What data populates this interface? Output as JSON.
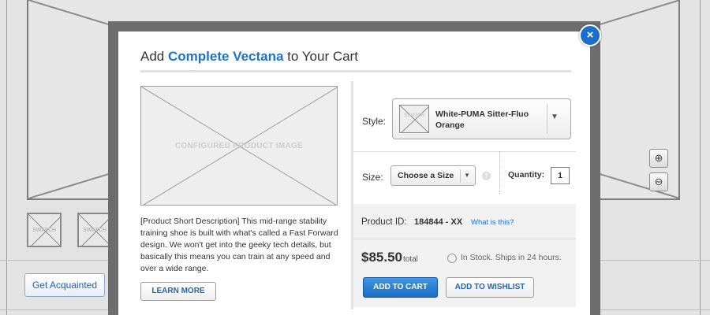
{
  "background": {
    "thumbnails": [
      "SWATCH",
      "SWATCH"
    ],
    "get_acquainted_label": "Get Acquainted",
    "zoom_in_glyph": "⊕",
    "zoom_out_glyph": "⊖"
  },
  "modal": {
    "title_prefix": "Add ",
    "title_product": "Complete Vectana",
    "title_suffix": " to Your Cart",
    "close_glyph": "×",
    "image_label": "CONFIGURED PRODUCT IMAGE",
    "description": "[Product Short Description]  This mid-range stability training shoe is built with what's called a Fast Forward design. We won't get into the geeky tech details, but basically this means you can train at any speed and over a wide range.",
    "learn_more_label": "LEARN MORE",
    "style": {
      "label": "Style:",
      "thumb_label": "SWATCH",
      "selected": "White-PUMA Sitter-Fluo Orange",
      "arrow": "▼"
    },
    "size": {
      "label": "Size:",
      "selected": "Choose a Size",
      "arrow": "▼",
      "help_glyph": "?"
    },
    "quantity": {
      "label": "Quantity:",
      "value": "1"
    },
    "product_id": {
      "label": "Product ID:",
      "value": "184844 - XX",
      "link": "What is this?"
    },
    "price": {
      "amount": "$85.50",
      "suffix": "total"
    },
    "stock_text": "In Stock. Ships in 24 hours.",
    "add_to_cart_label": "ADD TO CART",
    "add_to_wishlist_label": "ADD TO WISHLIST"
  },
  "colors": {
    "accent": "#1f72c6",
    "primary_button": "#1b6dc3",
    "overlay_border": "#6d6d6d"
  }
}
